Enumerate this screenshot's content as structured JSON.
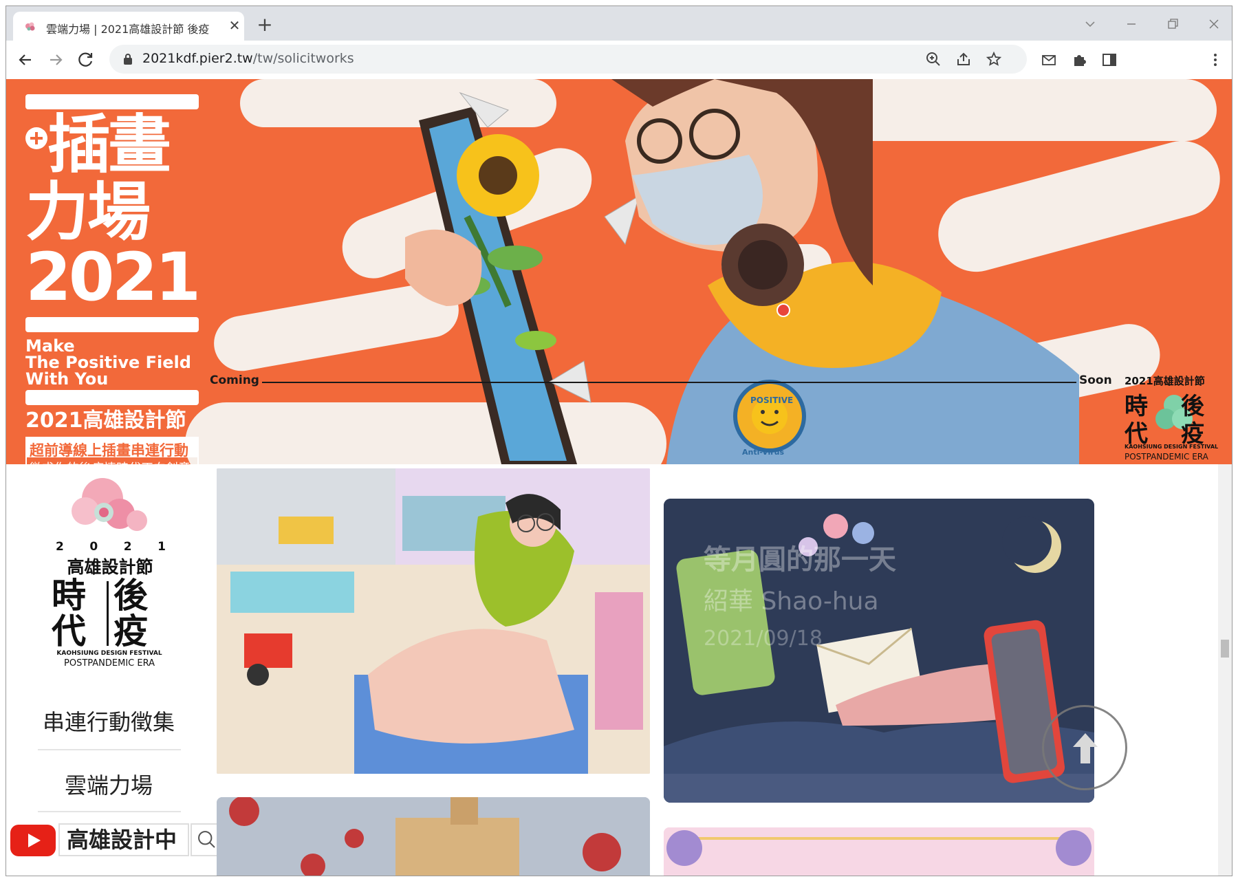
{
  "browser": {
    "tab_title": "雲端力場 | 2021高雄設計節 後疫",
    "url_domain": "2021kdf.pier2.tw",
    "url_path": "/tw/solicitworks",
    "new_tab_glyph": "+",
    "close_glyph": "✕"
  },
  "banner": {
    "title_line1": "插畫",
    "title_line2": "力場",
    "year": "2021",
    "slogan_line1": "Make",
    "slogan_line2": "The Positive Field",
    "slogan_line3": "With You",
    "festival": "2021高雄設計節",
    "subtitle": "超前導線上插畫串連行動",
    "subtitle2": "徵求你的後疫情時代正向創意",
    "coming": "Coming",
    "soon": "Soon",
    "badge_text": "POSITIVE",
    "badge_text2": "Anti-Virus",
    "logo_year": "2021高雄設計節",
    "logo_chars": [
      "時",
      "後",
      "代",
      "疫"
    ],
    "logo_en1": "KAOHSIUNG DESIGN FESTIVAL",
    "logo_en2": "POSTPANDEMIC ERA",
    "accent": "#f2693a"
  },
  "sidebar": {
    "logo_year_digits": [
      "2",
      "0",
      "2",
      "1"
    ],
    "logo_title": "高雄設計節",
    "logo_chars": [
      "時",
      "後",
      "代",
      "疫"
    ],
    "logo_en1": "KAOHSIUNG DESIGN FESTIVAL",
    "logo_en2": "POSTPANDEMIC ERA",
    "menu": [
      {
        "label": "串連行動徵集"
      },
      {
        "label": "雲端力場"
      }
    ],
    "youtube_label": "高雄設計中"
  },
  "works": [
    {
      "title": "",
      "artist": "",
      "date": ""
    },
    {
      "title": "等月圓的那一天",
      "artist": "紹華 Shao-hua",
      "date": "2021/09/18"
    },
    {
      "title": "",
      "artist": "",
      "date": ""
    },
    {
      "title": "",
      "artist": "",
      "date": ""
    }
  ],
  "back_to_top_icon": "arrow-up-icon"
}
